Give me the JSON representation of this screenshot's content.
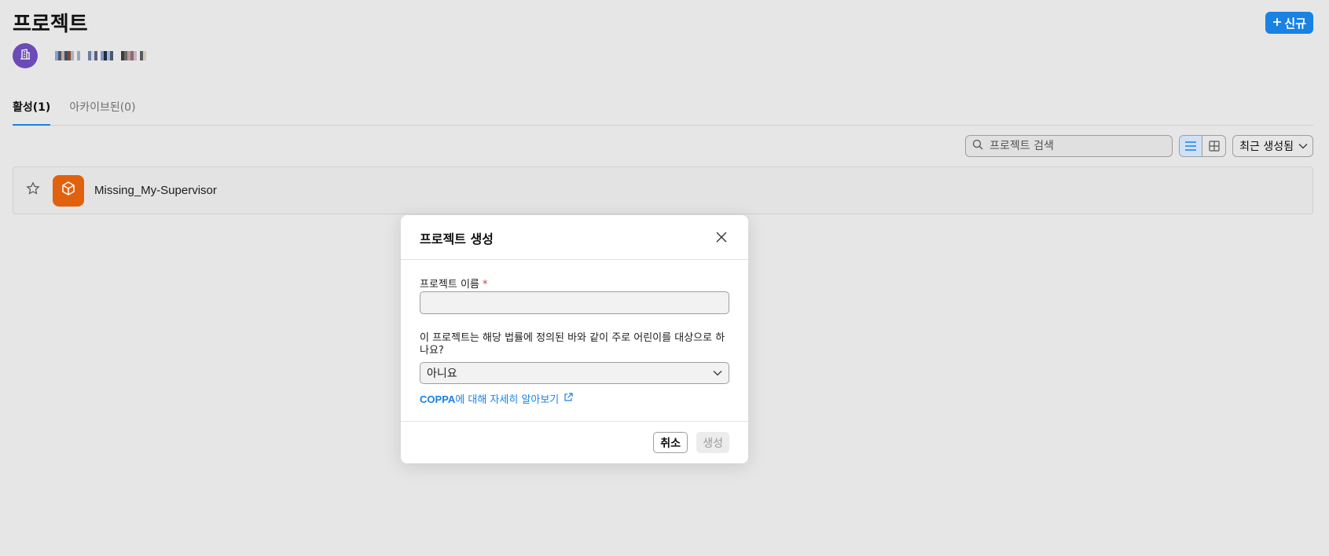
{
  "header": {
    "title": "프로젝트",
    "new_button_label": "신규"
  },
  "org": {
    "avatar_icon": "building-icon",
    "avatar_color": "#6b4bb6"
  },
  "tabs": [
    {
      "label": "활성(1)",
      "active": true
    },
    {
      "label": "아카이브된(0)",
      "active": false
    }
  ],
  "toolbar": {
    "search_placeholder": "프로젝트 검색",
    "sort_label": "최근 생성됨"
  },
  "projects": [
    {
      "name": "Missing_My-Supervisor",
      "icon": "cube-icon",
      "icon_color": "#e0620e"
    }
  ],
  "modal": {
    "title": "프로젝트 생성",
    "name_label": "프로젝트 이름",
    "required_mark": "*",
    "name_value": "",
    "coppa_question": "이 프로젝트는 해당 법률에 정의된 바와 같이 주로 어린이를 대상으로 하나요?",
    "coppa_selected": "아니요",
    "coppa_link_strong": "COPPA",
    "coppa_link_rest": "에 대해 자세히 알아보기",
    "cancel_label": "취소",
    "create_label": "생성"
  },
  "colors": {
    "accent": "#1a82e2",
    "background": "#e6e6e6"
  }
}
